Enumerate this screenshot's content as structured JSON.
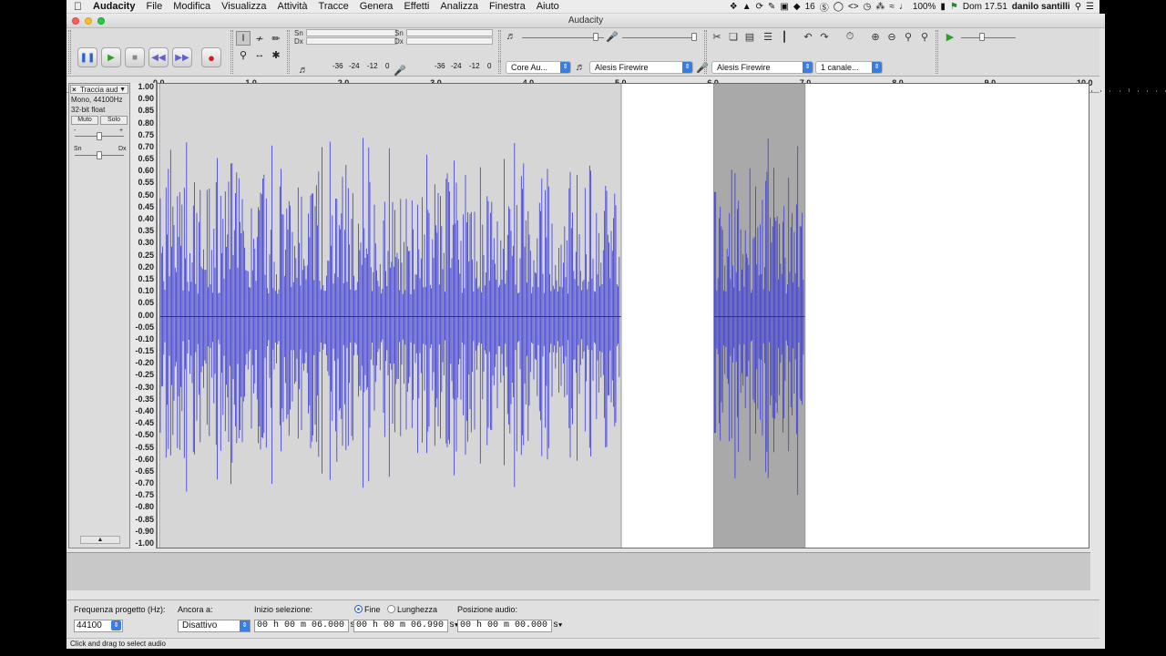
{
  "menubar": {
    "app_name": "Audacity",
    "items": [
      "File",
      "Modifica",
      "Visualizza",
      "Attività",
      "Tracce",
      "Genera",
      "Effetti",
      "Analizza",
      "Finestra",
      "Aiuto"
    ],
    "status": {
      "badge": "16",
      "battery": "100%",
      "clock": "Dom 17.51",
      "user": "danilo santilli"
    }
  },
  "window": {
    "title": "Audacity"
  },
  "toolbar": {
    "rec_meter": {
      "ch_left": "Sn",
      "ch_right": "Dx",
      "scale": [
        "-36",
        "-24",
        "-12",
        "0"
      ]
    },
    "play_meter": {
      "ch_left": "Sn",
      "ch_right": "Dx",
      "scale": [
        "-36",
        "-24",
        "-12",
        "0"
      ]
    },
    "host": "Core Au...",
    "output_device": "Alesis Firewire",
    "input_device": "Alesis Firewire",
    "channels": "1 canale..."
  },
  "ruler": {
    "ticks": [
      "0.0",
      "1.0",
      "2.0",
      "3.0",
      "4.0",
      "5.0",
      "6.0",
      "7.0",
      "8.0",
      "9.0",
      "10.0"
    ]
  },
  "track": {
    "name": "Traccia aud",
    "info_rate": "Mono, 44100Hz",
    "info_format": "32-bit float",
    "mute_label": "Muto",
    "solo_label": "Solo",
    "gain_minus": "-",
    "gain_plus": "+",
    "pan_left": "Sn",
    "pan_right": "Dx",
    "y_labels": [
      "1.00",
      "0.90",
      "0.85",
      "0.80",
      "0.75",
      "0.70",
      "0.65",
      "0.60",
      "0.55",
      "0.50",
      "0.45",
      "0.40",
      "0.35",
      "0.30",
      "0.25",
      "0.20",
      "0.15",
      "0.10",
      "0.05",
      "0.00",
      "-0.05",
      "-0.10",
      "-0.15",
      "-0.20",
      "-0.25",
      "-0.30",
      "-0.35",
      "-0.40",
      "-0.45",
      "-0.50",
      "-0.55",
      "-0.60",
      "-0.65",
      "-0.70",
      "-0.75",
      "-0.80",
      "-0.85",
      "-0.90",
      "-1.00"
    ],
    "clips": [
      {
        "start_s": 0.0,
        "end_s": 5.0
      },
      {
        "start_s": 6.0,
        "end_s": 6.99
      }
    ],
    "selection": {
      "start_s": 6.0,
      "end_s": 6.99
    },
    "waveform_color": "#3a3ad8"
  },
  "selection_bar": {
    "rate_label": "Frequenza progetto (Hz):",
    "rate_value": "44100",
    "snap_label": "Ancora a:",
    "snap_value": "Disattivo",
    "start_label": "Inizio selezione:",
    "end_radio": "Fine",
    "length_radio": "Lunghezza",
    "start_time": "00 h 00 m 06.000 s",
    "end_time": "00 h 00 m 06.990 s",
    "pos_label": "Posizione audio:",
    "pos_time": "00 h 00 m 00.000 s"
  },
  "status": {
    "text": "Click and drag to select audio"
  }
}
